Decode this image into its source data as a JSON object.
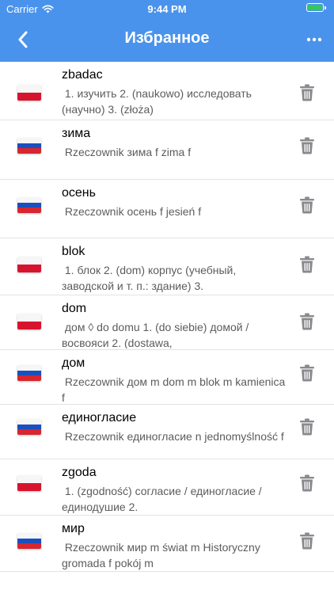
{
  "status_bar": {
    "carrier": "Carrier",
    "time": "9:44 PM",
    "battery_level": 1.0,
    "battery_color": "#34c759"
  },
  "nav": {
    "title": "Избранное",
    "back_icon": "chevron-left-icon",
    "more_icon": "ellipsis-icon",
    "bar_color": "#4a93ec"
  },
  "flag_colors": {
    "pl": [
      "#f6f6f6",
      "#d7142e"
    ],
    "ru": [
      "#f6f6f6",
      "#1a4fbf",
      "#d6262f"
    ]
  },
  "favorites": [
    {
      "flag": "pl",
      "word": "zbadac",
      "desc": " 1. изучить 2. (naukowo) исследовать (научно) 3. (złoża)"
    },
    {
      "flag": "ru",
      "word": "зима",
      "desc": " Rzeczownik зима f zima f"
    },
    {
      "flag": "ru",
      "word": "осень",
      "desc": " Rzeczownik осень f jesień f"
    },
    {
      "flag": "pl",
      "word": "blok",
      "desc": " 1. блок 2. (dom) корпус (учебный, заводской и т. п.: здание) 3."
    },
    {
      "flag": "pl",
      "word": "dom",
      "desc": " дом ◊ do domu 1. (do siebie) домой / восвояси 2. (dostawa,"
    },
    {
      "flag": "ru",
      "word": "дом",
      "desc": " Rzeczownik дом m dom m blok m kamienica f"
    },
    {
      "flag": "ru",
      "word": "единогласие",
      "desc": " Rzeczownik единогласие n jednomyślność f"
    },
    {
      "flag": "pl",
      "word": "zgoda",
      "desc": " 1. (zgodność) согласие / единогласие / единодушие 2."
    },
    {
      "flag": "ru",
      "word": "мир",
      "desc": " Rzeczownik мир m świat m Historyczny gromada f pokój m"
    }
  ]
}
